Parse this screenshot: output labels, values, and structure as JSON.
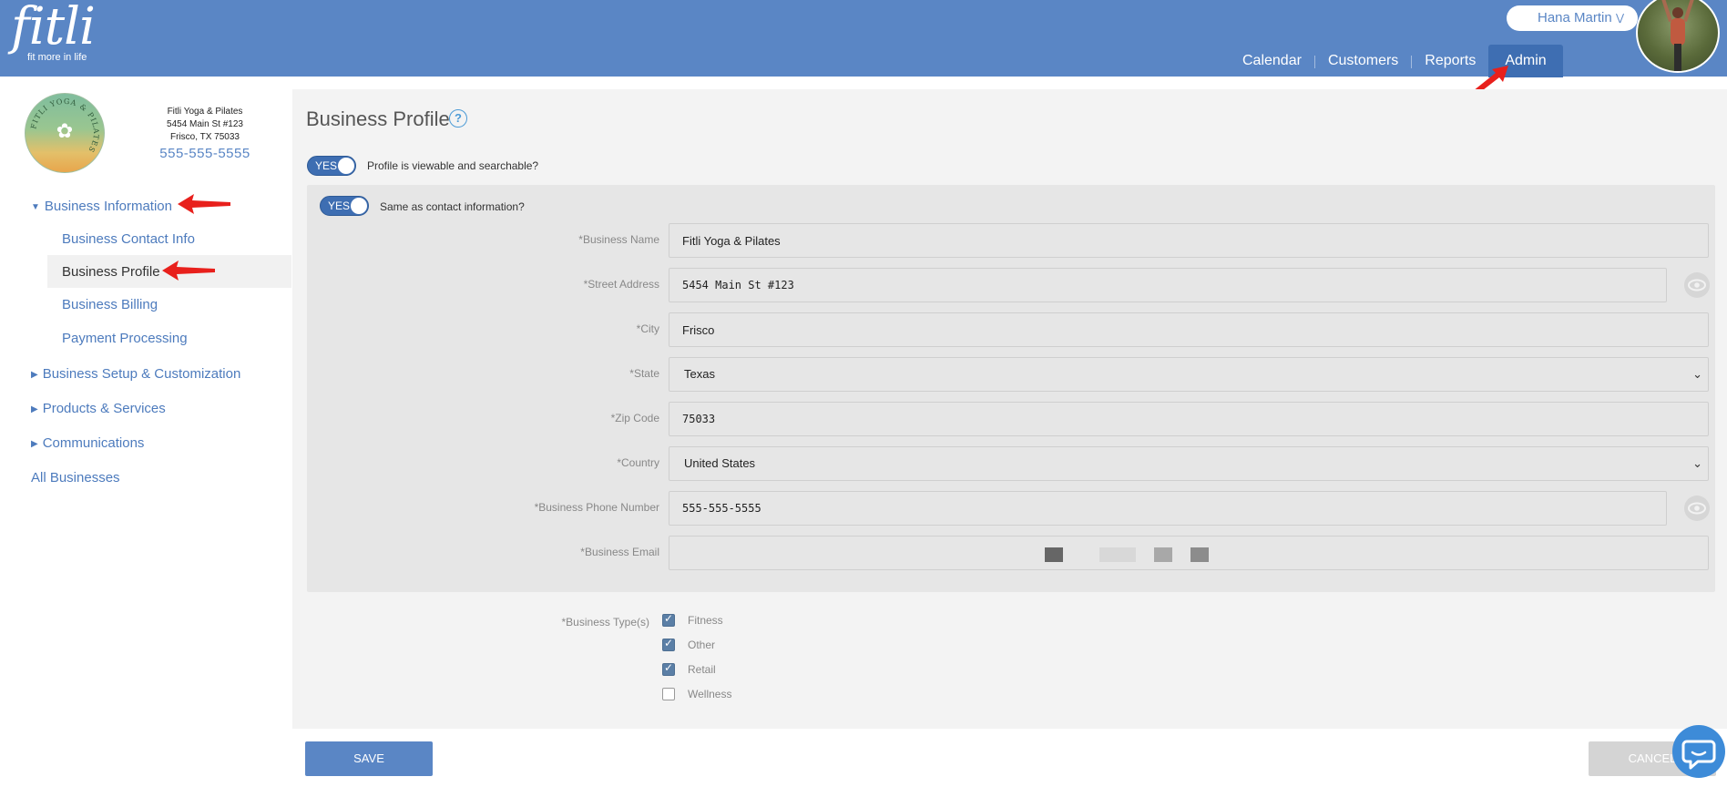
{
  "app": {
    "logo_text": "fitli",
    "logo_tagline": "fit more in life"
  },
  "header": {
    "nav": [
      {
        "label": "Calendar"
      },
      {
        "label": "Customers"
      },
      {
        "label": "Reports"
      },
      {
        "label": "Admin",
        "active": true
      }
    ],
    "user": {
      "name": "Hana Martin",
      "dropdown_icon": "chevron-down-icon"
    },
    "avatar_icon": "user-avatar"
  },
  "business": {
    "logo_ring_text": "FITLI YOGA & PILATES",
    "name": "Fitli Yoga & Pilates",
    "address_line1": "5454 Main St #123",
    "address_line2": "Frisco, TX 75033",
    "phone": "555-555-5555"
  },
  "sidebar": {
    "sections": [
      {
        "label": "Business Information",
        "expanded": true
      },
      {
        "label": "Business Setup & Customization",
        "expanded": false
      },
      {
        "label": "Products & Services",
        "expanded": false
      },
      {
        "label": "Communications",
        "expanded": false
      }
    ],
    "business_information_items": [
      {
        "label": "Business Contact Info"
      },
      {
        "label": "Business Profile",
        "active": true
      },
      {
        "label": "Business Billing"
      },
      {
        "label": "Payment Processing"
      }
    ],
    "all_businesses": "All Businesses"
  },
  "main": {
    "title": "Business Profile",
    "help_icon": "question-circle-icon",
    "profile_toggle": {
      "state": "YES",
      "label": "Profile is viewable and searchable?"
    },
    "contact_toggle": {
      "state": "YES",
      "label": "Same as contact information?"
    },
    "fields": {
      "business_name": {
        "label": "*Business Name",
        "value": "Fitli Yoga & Pilates"
      },
      "street_address": {
        "label": "*Street Address",
        "value": "5454 Main St #123"
      },
      "city": {
        "label": "*City",
        "value": "Frisco"
      },
      "state": {
        "label": "*State",
        "value": "Texas"
      },
      "zip": {
        "label": "*Zip Code",
        "value": "75033"
      },
      "country": {
        "label": "*Country",
        "value": "United States"
      },
      "phone": {
        "label": "*Business Phone Number",
        "value": "555-555-5555"
      },
      "email": {
        "label": "*Business Email",
        "value": ""
      }
    },
    "business_types": {
      "label": "*Business Type(s)",
      "options": [
        {
          "label": "Fitness",
          "checked": true
        },
        {
          "label": "Other",
          "checked": true
        },
        {
          "label": "Retail",
          "checked": true
        },
        {
          "label": "Wellness",
          "checked": false
        }
      ]
    }
  },
  "footer": {
    "save_label": "SAVE",
    "cancel_label": "CANCEL",
    "chat_icon": "chat-bubble-icon"
  },
  "colors": {
    "header_blue": "#5a86c5",
    "active_tab": "#3e6eb2",
    "link_blue": "#4d7bbd",
    "annotation_red": "#e8201c"
  }
}
